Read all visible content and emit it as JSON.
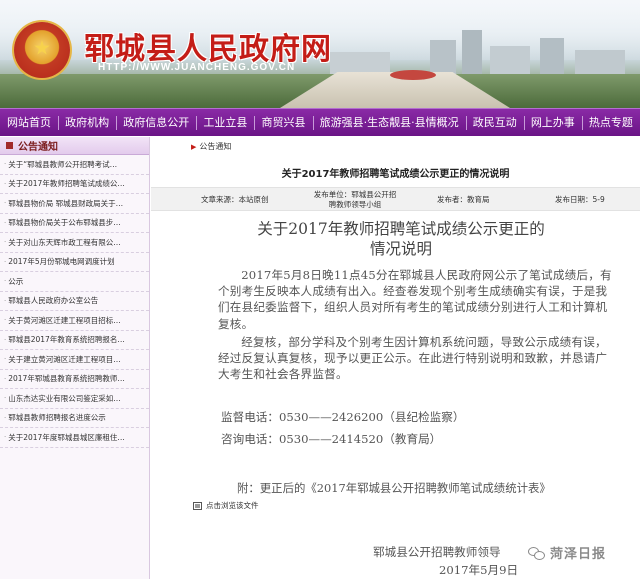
{
  "site": {
    "title": "郓城县人民政府网",
    "url": "HTTP://WWW.JUANCHENG.GOV.CN"
  },
  "nav": {
    "items": [
      "网站首页",
      "政府机构",
      "政府信息公开",
      "工业立县",
      "商贸兴县",
      "旅游强县·生态靓县·县情概况",
      "政民互动",
      "网上办事",
      "热点专题"
    ]
  },
  "sidebar": {
    "heading": "公告通知",
    "items": [
      "关于“郓城县教师公开招聘考试…",
      "关于2017年教师招聘笔试成绩公…",
      "郓城县物价局 郓城县财政局关于…",
      "郓城县物价局关于公布郓城县步…",
      "关于对山东天辉市政工程有限公…",
      "2017年5月份郓城电网调度计划",
      "公示",
      "郓城县人民政府办公室公告",
      "关于黄河滩区迁建工程项目招标…",
      "郓城县2017年教育系统招聘报名…",
      "关于建立黄河滩区迁建工程项目…",
      "2017年郓城县教育系统招聘教师…",
      "山东杰达实业有限公司鉴定采如…",
      "郓城县教师招聘报名进度公示",
      "关于2017年度郓城县城区廉租住…"
    ]
  },
  "article": {
    "breadcrumb": "公告通知",
    "title": "关于2017年教师招聘笔试成绩公示更正的情况说明",
    "meta": {
      "source_label": "文章来源：本站原创",
      "dept_label": "发布单位：郓城县公开招聘教师领导小组",
      "author_label": "发布者：教育局",
      "date_label": "发布日期：5-9"
    },
    "doc_title_line1": "关于2017年教师招聘笔试成绩公示更正的",
    "doc_title_line2": "情况说明",
    "para1": "2017年5月8日晚11点45分在郓城县人民政府网公示了笔试成绩后，有个别考生反映本人成绩有出入。经查卷发现个别考生成绩确实有误，于是我们在县纪委监督下，组织人员对所有考生的笔试成绩分别进行人工和计算机复核。",
    "para2": "经复核，部分学科及个别考生因计算机系统问题，导致公示成绩有误，经过反复认真复核，现予以更正公示。在此进行特别说明和致歉，并恳请广大考生和社会各界监督。",
    "contact1": "监督电话：0530——2426200（县纪检监察）",
    "contact2": "咨询电话：0530——2414520（教育局）",
    "attachment": "附：更正后的《2017年郓城县公开招聘教师笔试成绩统计表》",
    "download_label": "点击浏览该文件",
    "signer": "郓城县公开招聘教师领导",
    "date": "2017年5月9日"
  },
  "watermark": {
    "text": "菏泽日报"
  }
}
